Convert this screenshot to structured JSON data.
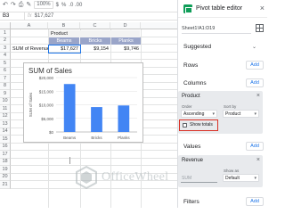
{
  "toolbar": {
    "zoom": "100%",
    "currency": "$",
    "percent": "%",
    "decimals": ".0  .00"
  },
  "formula_bar": {
    "cell_ref": "B3",
    "fx": "fx",
    "value": "$17,627"
  },
  "grid": {
    "columns": [
      "A",
      "B",
      "C",
      "D"
    ],
    "rows": [
      "1",
      "2",
      "3",
      "4",
      "5",
      "6",
      "7",
      "8",
      "9",
      "10",
      "11",
      "12",
      "13",
      "14",
      "15",
      "16",
      "17",
      "18",
      "19",
      "20",
      "21"
    ]
  },
  "pivot": {
    "header_label": "Product",
    "columns": [
      "Beams",
      "Bricks",
      "Planks"
    ],
    "row_label": "SUM of Revenue",
    "values": [
      "$17,627",
      "$9,154",
      "$9,746"
    ]
  },
  "chart_data": {
    "type": "bar",
    "title": "SUM of Sales",
    "xlabel": "",
    "ylabel": "SUM of Sales",
    "categories": [
      "Beams",
      "Bricks",
      "Planks"
    ],
    "values": [
      17627,
      9154,
      9746
    ],
    "yticks": [
      "$0",
      "$5,000",
      "$10,000",
      "$15,000",
      "$20,000"
    ],
    "ylim": [
      0,
      20000
    ],
    "color": "#4285f4",
    "grid": true
  },
  "watermark": {
    "text": "OfficeWheel"
  },
  "editor": {
    "title": "Pivot table editor",
    "range": "Sheet1!A1:D19",
    "suggested_label": "Suggested",
    "rows_label": "Rows",
    "columns_label": "Columns",
    "values_label": "Values",
    "filters_label": "Filters",
    "add_label": "Add",
    "columns_field": {
      "name": "Product",
      "order_label": "Order",
      "order_value": "Ascending",
      "sort_by_label": "Sort by",
      "sort_by_value": "Product",
      "show_totals_label": "Show totals",
      "show_totals_checked": false
    },
    "values_field": {
      "name": "Revenue",
      "summarize_value": "SUM",
      "show_as_label": "Show as",
      "show_as_value": "Default"
    }
  },
  "colors": {
    "pivot_header_blue": "#9aa5c9",
    "bar": "#4285f4",
    "highlight_red": "#d93025",
    "sheets_green": "#0f9d58"
  }
}
